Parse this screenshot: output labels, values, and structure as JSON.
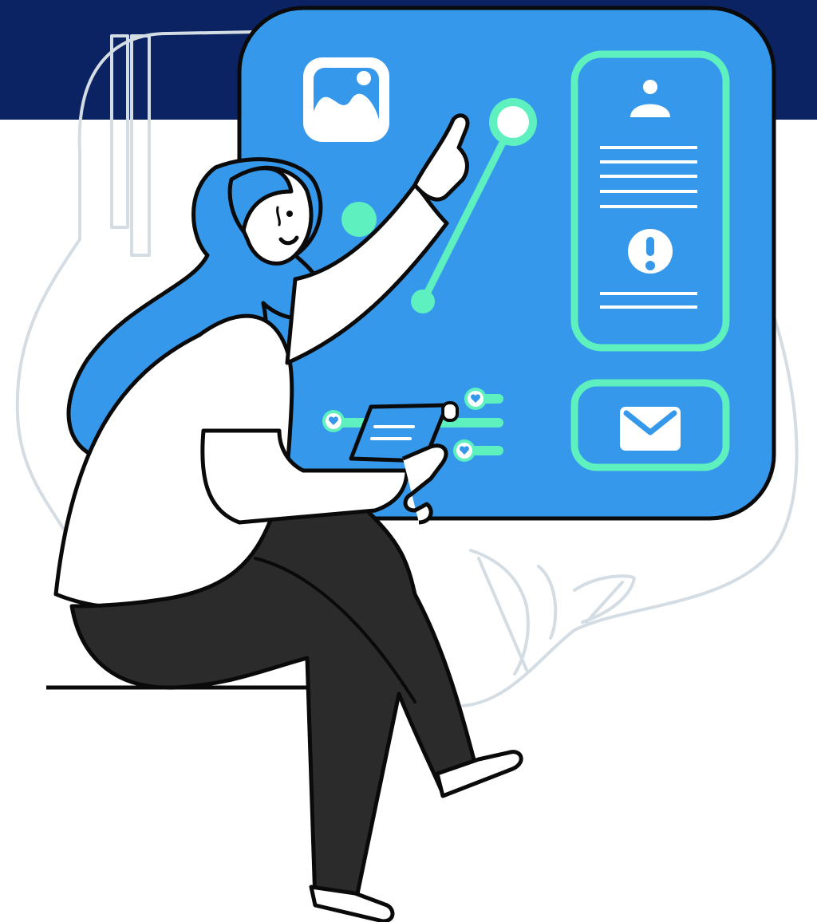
{
  "colors": {
    "band": "#0b2263",
    "screen": "#3598ea",
    "accent": "#5ef1bf",
    "outline": "#0a0a0a",
    "hair": "#3598ea",
    "pants": "#2b2b2b",
    "sketch": "#d3dde3",
    "white": "#ffffff"
  },
  "icons": {
    "image": "image-icon",
    "user": "user-icon",
    "alert": "exclamation-icon",
    "mail": "envelope-icon",
    "hearts": "heart-icon"
  }
}
